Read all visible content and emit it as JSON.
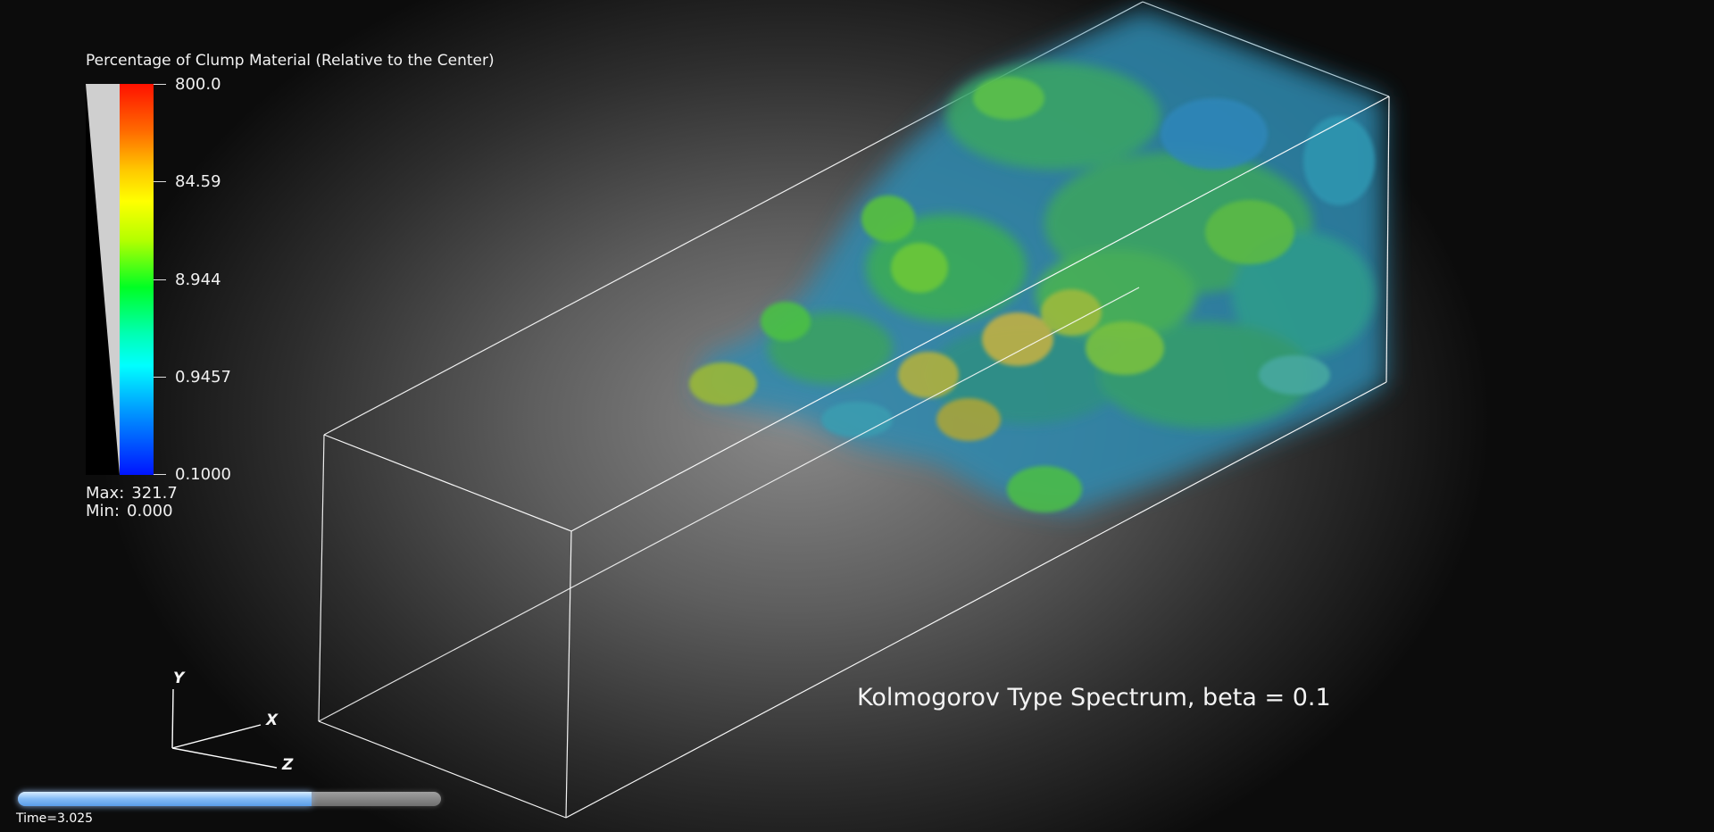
{
  "legend": {
    "title": "Percentage of Clump Material (Relative to the Center)",
    "ticks": [
      "800.0",
      "84.59",
      "8.944",
      "0.9457",
      "0.1000"
    ],
    "max_label": "Max:",
    "max_value": "321.7",
    "min_label": "Min:",
    "min_value": "0.000"
  },
  "caption": "Kolmogorov Type Spectrum, beta = 0.1",
  "axes": {
    "x": "X",
    "y": "Y",
    "z": "Z"
  },
  "timeline": {
    "label": "Time=3.025",
    "progress": 0.695
  },
  "colors": {
    "box_outline": "#ffffff",
    "cloud_green": "#46c832",
    "cloud_blue": "#2882b4",
    "cloud_yellow": "#c8b41e",
    "progress_fill": "#82baf5"
  }
}
